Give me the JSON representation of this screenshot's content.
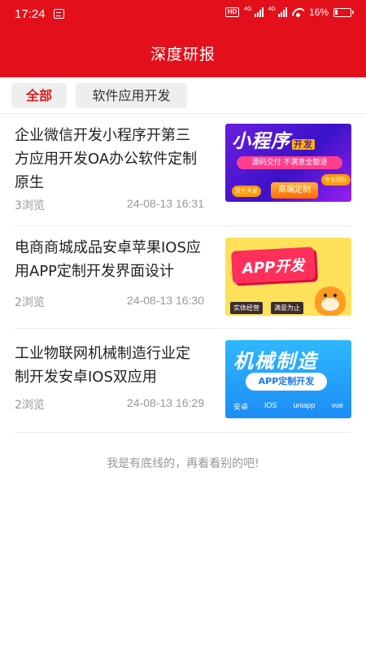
{
  "status_bar": {
    "time": "17:24",
    "network_labels": [
      "4G",
      "4G"
    ],
    "hd_label": "HD",
    "battery": "16%"
  },
  "header": {
    "title": "深度研报",
    "color": "#e3101c"
  },
  "tabs": [
    {
      "label": "全部",
      "active": true
    },
    {
      "label": "软件应用开发",
      "active": false
    }
  ],
  "articles": [
    {
      "title_lines": [
        "企业微信开发小程序开第三",
        "方应用开发OA办公软件定制",
        "原生"
      ],
      "views": "3浏览",
      "date": "24-08-13 16:31",
      "thumb": {
        "title": "小程序",
        "badge": "开发",
        "band": "源码交付  不满意全额退",
        "button": "高端定制",
        "tag_left": "原生开发",
        "tag_right": "专业团队"
      }
    },
    {
      "title_lines": [
        "电商商城成品安卓苹果IOS应",
        "用APP定制开发界面设计"
      ],
      "views": "2浏览",
      "date": "24-08-13 16:30",
      "thumb": {
        "title": "APP开发",
        "pills": [
          "实体经营",
          "满意为止"
        ]
      }
    },
    {
      "title_lines": [
        "工业物联网机械制造行业定",
        "制开发安卓IOS双应用"
      ],
      "views": "2浏览",
      "date": "24-08-13 16:29",
      "thumb": {
        "title": "机械制造",
        "pill": "APP定制开发",
        "techs": [
          "安卓",
          "IOS",
          "uniapp",
          "vue"
        ]
      }
    }
  ],
  "footer_note": "我是有底线的，再看看别的吧!"
}
